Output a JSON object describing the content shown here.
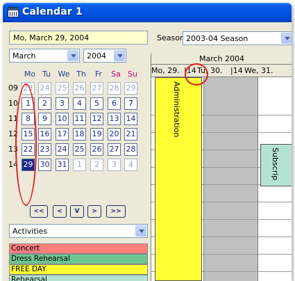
{
  "window": {
    "title": "Calendar  1"
  },
  "selected_date": "Mo, March 29, 2004",
  "month_select": {
    "value": "March"
  },
  "year_select": {
    "value": "2004"
  },
  "season": {
    "label": "Season",
    "value": "2003-04 Season"
  },
  "weekdays": [
    "Mo",
    "Tu",
    "We",
    "Th",
    "Fr",
    "Sa",
    "Su"
  ],
  "weeks": [
    {
      "num": "09",
      "days": [
        "23",
        "24",
        "25",
        "26",
        "27",
        "28",
        "29"
      ],
      "other": [
        true,
        true,
        true,
        true,
        true,
        true,
        true
      ]
    },
    {
      "num": "10",
      "days": [
        "1",
        "2",
        "3",
        "4",
        "5",
        "6",
        "7"
      ],
      "other": [
        false,
        false,
        false,
        false,
        false,
        false,
        false
      ]
    },
    {
      "num": "11",
      "days": [
        "8",
        "9",
        "10",
        "11",
        "12",
        "13",
        "14"
      ],
      "other": [
        false,
        false,
        false,
        false,
        false,
        false,
        false
      ]
    },
    {
      "num": "12",
      "days": [
        "15",
        "16",
        "17",
        "18",
        "19",
        "20",
        "21"
      ],
      "other": [
        false,
        false,
        false,
        false,
        false,
        false,
        false
      ]
    },
    {
      "num": "13",
      "days": [
        "22",
        "23",
        "24",
        "25",
        "26",
        "27",
        "28"
      ],
      "other": [
        false,
        false,
        false,
        false,
        false,
        false,
        false
      ]
    },
    {
      "num": "14",
      "days": [
        "29",
        "30",
        "31",
        "1",
        "2",
        "3",
        "4"
      ],
      "other": [
        false,
        false,
        false,
        true,
        true,
        true,
        true
      ]
    }
  ],
  "nav_buttons": [
    "<<",
    "<",
    "V",
    ">",
    ">>"
  ],
  "activities": {
    "select_value": "Activities",
    "items": [
      {
        "label": "Concert",
        "color": "#ff7f7f"
      },
      {
        "label": "Dress Rehearsal",
        "color": "#6fc58f"
      },
      {
        "label": "FREE DAY",
        "color": "#ffff33"
      },
      {
        "label": "Rehearsal",
        "color": "#b3e3cf"
      }
    ]
  },
  "schedule": {
    "month_title": "March  2004",
    "day_headers": [
      "Mo, 29.",
      "|14",
      "Tu, 30.",
      "|14",
      "We, 31."
    ],
    "events": [
      {
        "label": "Administration",
        "color": "#ffff33"
      },
      {
        "label": "Subscrip",
        "color": "#b3e3cf"
      }
    ]
  },
  "colors": {
    "annotation": "#e11b22",
    "titlebar": "#0055e5"
  }
}
